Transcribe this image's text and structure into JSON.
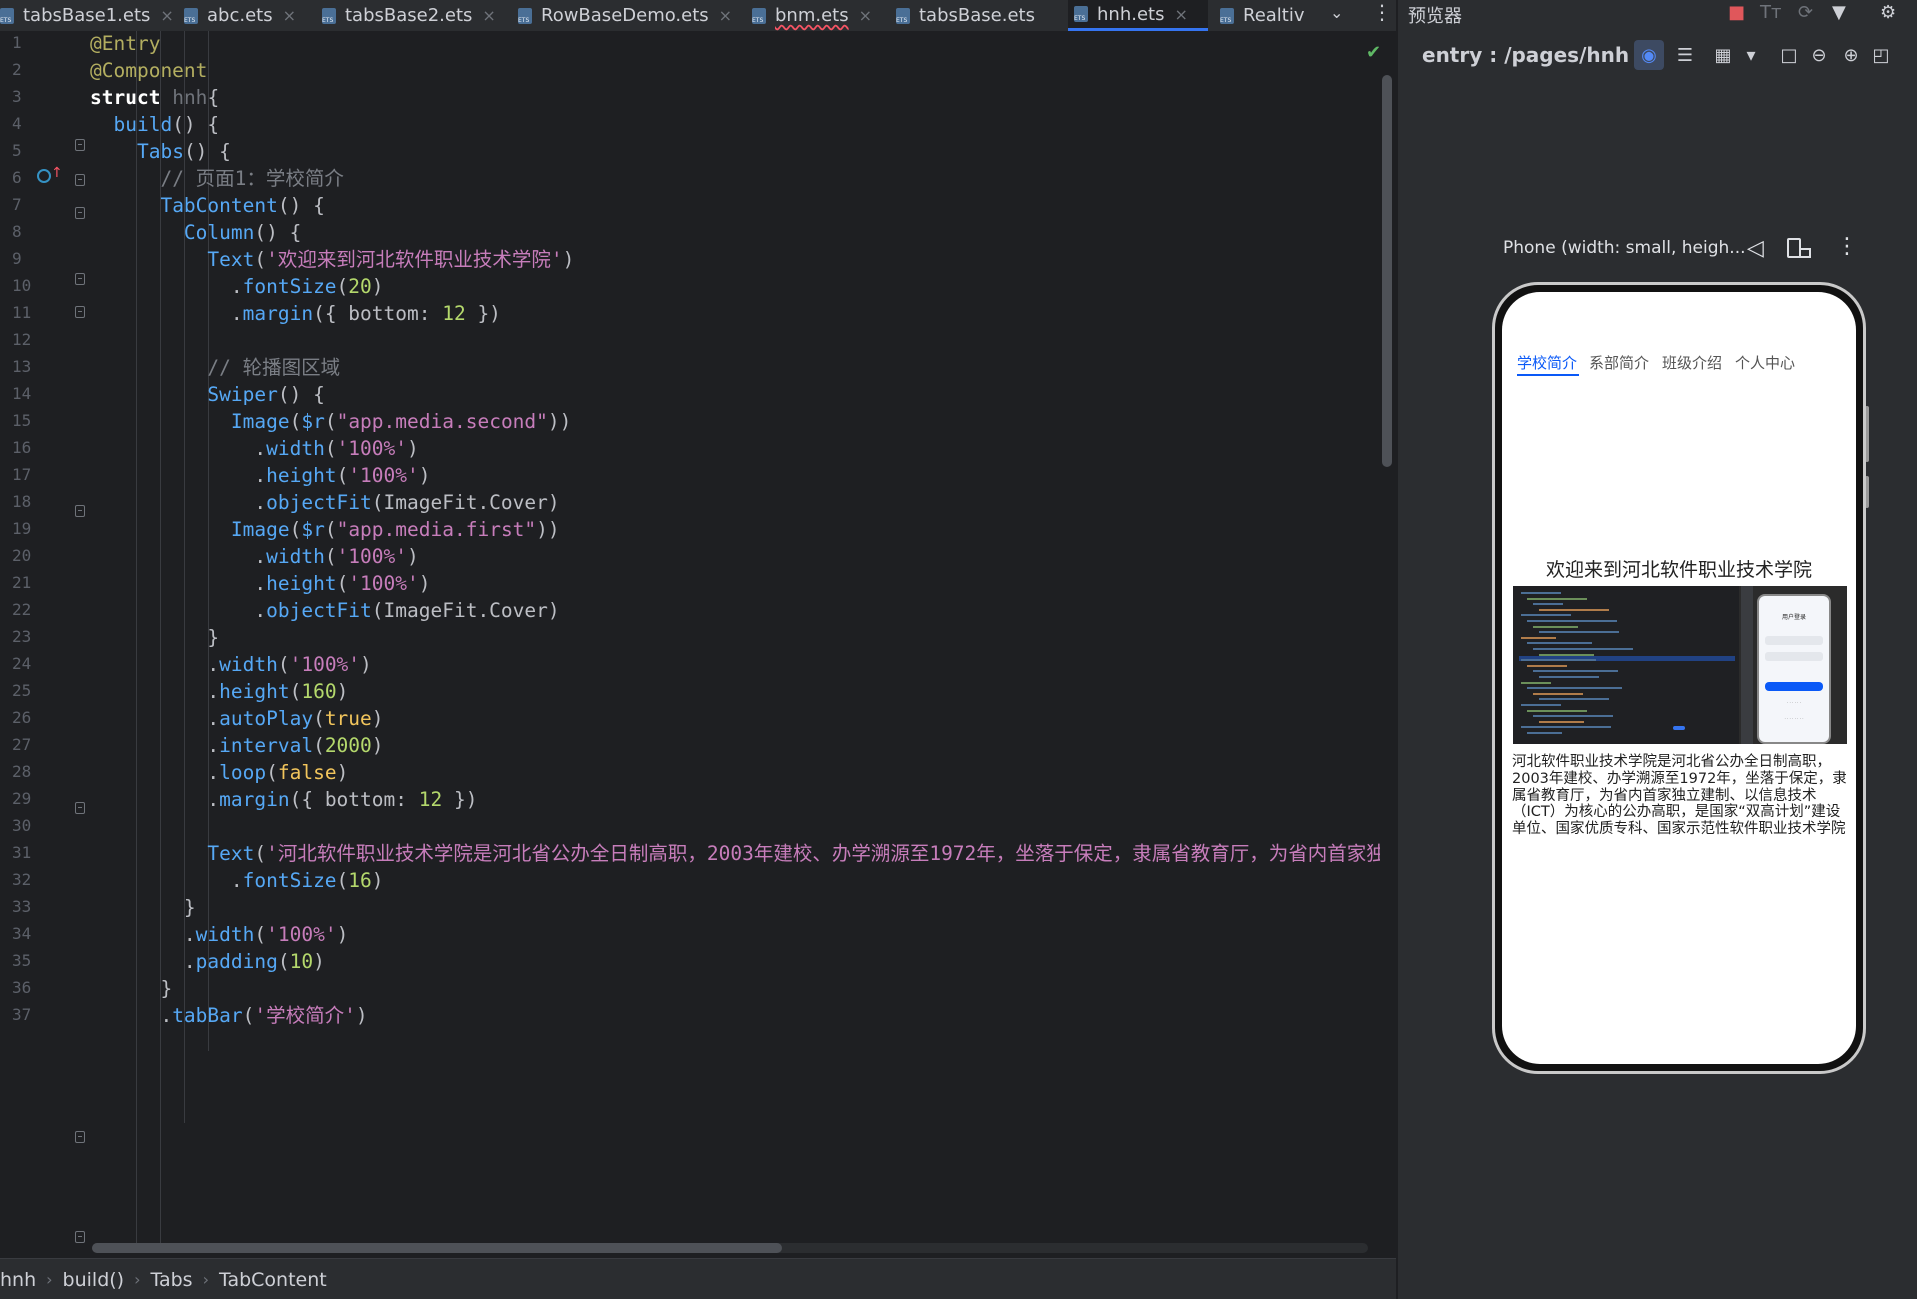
{
  "editor": {
    "tabs": [
      {
        "name": "tabsBase1.ets",
        "active": false,
        "closable": true
      },
      {
        "name": "abc.ets",
        "active": false,
        "closable": true
      },
      {
        "name": "tabsBase2.ets",
        "active": false,
        "closable": true
      },
      {
        "name": "RowBaseDemo.ets",
        "active": false,
        "closable": true
      },
      {
        "name": "bnm.ets",
        "active": false,
        "closable": true,
        "error": true
      },
      {
        "name": "tabsBase.ets",
        "active": false,
        "closable": false
      },
      {
        "name": "hnh.ets",
        "active": true,
        "closable": true
      },
      {
        "name": "Realtiv",
        "active": false,
        "closable": false
      }
    ],
    "tab_close_glyph": "×",
    "line_numbers": [
      "1",
      "2",
      "3",
      "4",
      "5",
      "6",
      "7",
      "8",
      "9",
      "10",
      "11",
      "12",
      "13",
      "14",
      "15",
      "16",
      "17",
      "18",
      "19",
      "20",
      "21",
      "22",
      "23",
      "24",
      "25",
      "26",
      "27",
      "28",
      "29",
      "30",
      "31",
      "32",
      "33",
      "34",
      "35",
      "36",
      "37"
    ],
    "code_lines": [
      [
        {
          "t": "@Entry",
          "c": "ann"
        }
      ],
      [
        {
          "t": "@Component",
          "c": "ann"
        }
      ],
      [
        {
          "t": "struct",
          "c": "kwb"
        },
        {
          "t": " "
        },
        {
          "t": "hnh",
          "c": "cn"
        },
        {
          "t": "{"
        }
      ],
      [
        {
          "t": "  "
        },
        {
          "t": "build",
          "c": "fn"
        },
        {
          "t": "() {"
        }
      ],
      [
        {
          "t": "    "
        },
        {
          "t": "Tabs",
          "c": "cmp"
        },
        {
          "t": "() {"
        }
      ],
      [
        {
          "t": "      "
        },
        {
          "t": "// 页面1：学校简介",
          "c": "cmt"
        }
      ],
      [
        {
          "t": "      "
        },
        {
          "t": "TabContent",
          "c": "cmp"
        },
        {
          "t": "() {"
        }
      ],
      [
        {
          "t": "        "
        },
        {
          "t": "Column",
          "c": "cmp"
        },
        {
          "t": "() {"
        }
      ],
      [
        {
          "t": "          "
        },
        {
          "t": "Text",
          "c": "cmp"
        },
        {
          "t": "("
        },
        {
          "t": "'欢迎来到河北软件职业技术学院'",
          "c": "str"
        },
        {
          "t": ")"
        }
      ],
      [
        {
          "t": "            ."
        },
        {
          "t": "fontSize",
          "c": "meth"
        },
        {
          "t": "("
        },
        {
          "t": "20",
          "c": "num"
        },
        {
          "t": ")"
        }
      ],
      [
        {
          "t": "            ."
        },
        {
          "t": "margin",
          "c": "meth"
        },
        {
          "t": "({ bottom: "
        },
        {
          "t": "12",
          "c": "num"
        },
        {
          "t": " })"
        }
      ],
      [
        {
          "t": ""
        }
      ],
      [
        {
          "t": "          "
        },
        {
          "t": "// 轮播图区域",
          "c": "cmt"
        }
      ],
      [
        {
          "t": "          "
        },
        {
          "t": "Swiper",
          "c": "cmp"
        },
        {
          "t": "() {"
        }
      ],
      [
        {
          "t": "            "
        },
        {
          "t": "Image",
          "c": "cmp"
        },
        {
          "t": "("
        },
        {
          "t": "$r",
          "c": "meth"
        },
        {
          "t": "("
        },
        {
          "t": "\"app.media.second\"",
          "c": "str"
        },
        {
          "t": "))"
        }
      ],
      [
        {
          "t": "              ."
        },
        {
          "t": "width",
          "c": "meth"
        },
        {
          "t": "("
        },
        {
          "t": "'100%'",
          "c": "str"
        },
        {
          "t": ")"
        }
      ],
      [
        {
          "t": "              ."
        },
        {
          "t": "height",
          "c": "meth"
        },
        {
          "t": "("
        },
        {
          "t": "'100%'",
          "c": "str"
        },
        {
          "t": ")"
        }
      ],
      [
        {
          "t": "              ."
        },
        {
          "t": "objectFit",
          "c": "meth"
        },
        {
          "t": "(ImageFit.Cover)"
        }
      ],
      [
        {
          "t": "            "
        },
        {
          "t": "Image",
          "c": "cmp"
        },
        {
          "t": "("
        },
        {
          "t": "$r",
          "c": "meth"
        },
        {
          "t": "("
        },
        {
          "t": "\"app.media.first\"",
          "c": "str"
        },
        {
          "t": "))"
        }
      ],
      [
        {
          "t": "              ."
        },
        {
          "t": "width",
          "c": "meth"
        },
        {
          "t": "("
        },
        {
          "t": "'100%'",
          "c": "str"
        },
        {
          "t": ")"
        }
      ],
      [
        {
          "t": "              ."
        },
        {
          "t": "height",
          "c": "meth"
        },
        {
          "t": "("
        },
        {
          "t": "'100%'",
          "c": "str"
        },
        {
          "t": ")"
        }
      ],
      [
        {
          "t": "              ."
        },
        {
          "t": "objectFit",
          "c": "meth"
        },
        {
          "t": "(ImageFit.Cover)"
        }
      ],
      [
        {
          "t": "          }"
        }
      ],
      [
        {
          "t": "          ."
        },
        {
          "t": "width",
          "c": "meth"
        },
        {
          "t": "("
        },
        {
          "t": "'100%'",
          "c": "str"
        },
        {
          "t": ")"
        }
      ],
      [
        {
          "t": "          ."
        },
        {
          "t": "height",
          "c": "meth"
        },
        {
          "t": "("
        },
        {
          "t": "160",
          "c": "num"
        },
        {
          "t": ")"
        }
      ],
      [
        {
          "t": "          ."
        },
        {
          "t": "autoPlay",
          "c": "meth"
        },
        {
          "t": "("
        },
        {
          "t": "true",
          "c": "ytext"
        },
        {
          "t": ")"
        }
      ],
      [
        {
          "t": "          ."
        },
        {
          "t": "interval",
          "c": "meth"
        },
        {
          "t": "("
        },
        {
          "t": "2000",
          "c": "num"
        },
        {
          "t": ")"
        }
      ],
      [
        {
          "t": "          ."
        },
        {
          "t": "loop",
          "c": "meth"
        },
        {
          "t": "("
        },
        {
          "t": "false",
          "c": "ytext"
        },
        {
          "t": ")"
        }
      ],
      [
        {
          "t": "          ."
        },
        {
          "t": "margin",
          "c": "meth"
        },
        {
          "t": "({ bottom: "
        },
        {
          "t": "12",
          "c": "num"
        },
        {
          "t": " })"
        }
      ],
      [
        {
          "t": ""
        }
      ],
      [
        {
          "t": "          "
        },
        {
          "t": "Text",
          "c": "cmp"
        },
        {
          "t": "("
        },
        {
          "t": "'河北软件职业技术学院是河北省公办全日制高职，2003年建校、办学溯源至1972年，坐落于保定，隶属省教育厅，为省内首家独立建",
          "c": "str"
        }
      ],
      [
        {
          "t": "            ."
        },
        {
          "t": "fontSize",
          "c": "meth"
        },
        {
          "t": "("
        },
        {
          "t": "16",
          "c": "num"
        },
        {
          "t": ")"
        }
      ],
      [
        {
          "t": "        }"
        }
      ],
      [
        {
          "t": "        ."
        },
        {
          "t": "width",
          "c": "meth"
        },
        {
          "t": "("
        },
        {
          "t": "'100%'",
          "c": "str"
        },
        {
          "t": ")"
        }
      ],
      [
        {
          "t": "        ."
        },
        {
          "t": "padding",
          "c": "meth"
        },
        {
          "t": "("
        },
        {
          "t": "10",
          "c": "num"
        },
        {
          "t": ")"
        }
      ],
      [
        {
          "t": "      }"
        }
      ],
      [
        {
          "t": "      ."
        },
        {
          "t": "tabBar",
          "c": "meth"
        },
        {
          "t": "("
        },
        {
          "t": "'学校简介'",
          "c": "str"
        },
        {
          "t": ")"
        }
      ]
    ],
    "breadcrumb": [
      "hnh",
      "build()",
      "Tabs",
      "TabContent"
    ],
    "breadcrumb_sep": "›"
  },
  "previewer": {
    "title": "预览器",
    "entry": "entry : /pages/hnh",
    "device_label": "Phone (width: small, heigh...",
    "app": {
      "tabs": [
        "学校简介",
        "系部简介",
        "班级介绍",
        "个人中心"
      ],
      "active_tab": 0,
      "welcome": "欢迎来到河北软件职业技术学院",
      "intro": "河北软件职业技术学院是河北省公办全日制高职，2003年建校、办学溯源至1972年，坐落于保定，隶属省教育厅，为省内首家独立建制、以信息技术（ICT）为核心的公办高职，是国家“双高计划”建设单位、国家优质专科、国家示范性软件职业技术学院",
      "swiper_preview_title": "用户登录"
    }
  },
  "colors": {
    "editor_bg": "#1e1f22",
    "panel_bg": "#2b2d30",
    "accent": "#3574f0",
    "app_accent": "#0a59f7"
  },
  "icons": [
    "ets-file-icon",
    "close-icon",
    "chevron-down-icon",
    "more-vertical-icon",
    "check-icon",
    "override-icon",
    "stop-icon",
    "text-size-icon",
    "refresh-icon",
    "pin-icon",
    "settings-icon",
    "inspect-icon",
    "layers-icon",
    "grid-icon",
    "frame-icon",
    "zoom-out-icon",
    "zoom-in-icon",
    "fit-icon",
    "back-icon",
    "rotate-icon"
  ]
}
